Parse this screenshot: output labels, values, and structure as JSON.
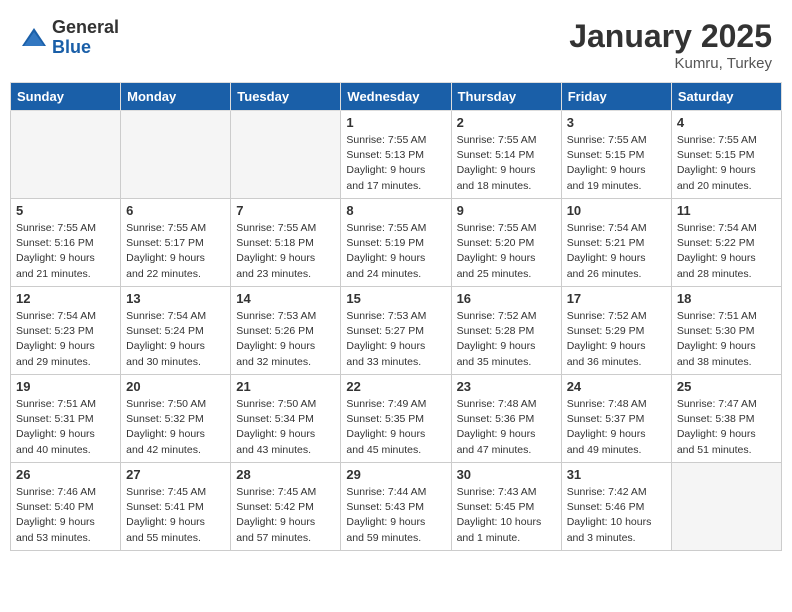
{
  "header": {
    "logo_general": "General",
    "logo_blue": "Blue",
    "title": "January 2025",
    "subtitle": "Kumru, Turkey"
  },
  "days_of_week": [
    "Sunday",
    "Monday",
    "Tuesday",
    "Wednesday",
    "Thursday",
    "Friday",
    "Saturday"
  ],
  "weeks": [
    [
      {
        "day": "",
        "info": ""
      },
      {
        "day": "",
        "info": ""
      },
      {
        "day": "",
        "info": ""
      },
      {
        "day": "1",
        "info": "Sunrise: 7:55 AM\nSunset: 5:13 PM\nDaylight: 9 hours\nand 17 minutes."
      },
      {
        "day": "2",
        "info": "Sunrise: 7:55 AM\nSunset: 5:14 PM\nDaylight: 9 hours\nand 18 minutes."
      },
      {
        "day": "3",
        "info": "Sunrise: 7:55 AM\nSunset: 5:15 PM\nDaylight: 9 hours\nand 19 minutes."
      },
      {
        "day": "4",
        "info": "Sunrise: 7:55 AM\nSunset: 5:15 PM\nDaylight: 9 hours\nand 20 minutes."
      }
    ],
    [
      {
        "day": "5",
        "info": "Sunrise: 7:55 AM\nSunset: 5:16 PM\nDaylight: 9 hours\nand 21 minutes."
      },
      {
        "day": "6",
        "info": "Sunrise: 7:55 AM\nSunset: 5:17 PM\nDaylight: 9 hours\nand 22 minutes."
      },
      {
        "day": "7",
        "info": "Sunrise: 7:55 AM\nSunset: 5:18 PM\nDaylight: 9 hours\nand 23 minutes."
      },
      {
        "day": "8",
        "info": "Sunrise: 7:55 AM\nSunset: 5:19 PM\nDaylight: 9 hours\nand 24 minutes."
      },
      {
        "day": "9",
        "info": "Sunrise: 7:55 AM\nSunset: 5:20 PM\nDaylight: 9 hours\nand 25 minutes."
      },
      {
        "day": "10",
        "info": "Sunrise: 7:54 AM\nSunset: 5:21 PM\nDaylight: 9 hours\nand 26 minutes."
      },
      {
        "day": "11",
        "info": "Sunrise: 7:54 AM\nSunset: 5:22 PM\nDaylight: 9 hours\nand 28 minutes."
      }
    ],
    [
      {
        "day": "12",
        "info": "Sunrise: 7:54 AM\nSunset: 5:23 PM\nDaylight: 9 hours\nand 29 minutes."
      },
      {
        "day": "13",
        "info": "Sunrise: 7:54 AM\nSunset: 5:24 PM\nDaylight: 9 hours\nand 30 minutes."
      },
      {
        "day": "14",
        "info": "Sunrise: 7:53 AM\nSunset: 5:26 PM\nDaylight: 9 hours\nand 32 minutes."
      },
      {
        "day": "15",
        "info": "Sunrise: 7:53 AM\nSunset: 5:27 PM\nDaylight: 9 hours\nand 33 minutes."
      },
      {
        "day": "16",
        "info": "Sunrise: 7:52 AM\nSunset: 5:28 PM\nDaylight: 9 hours\nand 35 minutes."
      },
      {
        "day": "17",
        "info": "Sunrise: 7:52 AM\nSunset: 5:29 PM\nDaylight: 9 hours\nand 36 minutes."
      },
      {
        "day": "18",
        "info": "Sunrise: 7:51 AM\nSunset: 5:30 PM\nDaylight: 9 hours\nand 38 minutes."
      }
    ],
    [
      {
        "day": "19",
        "info": "Sunrise: 7:51 AM\nSunset: 5:31 PM\nDaylight: 9 hours\nand 40 minutes."
      },
      {
        "day": "20",
        "info": "Sunrise: 7:50 AM\nSunset: 5:32 PM\nDaylight: 9 hours\nand 42 minutes."
      },
      {
        "day": "21",
        "info": "Sunrise: 7:50 AM\nSunset: 5:34 PM\nDaylight: 9 hours\nand 43 minutes."
      },
      {
        "day": "22",
        "info": "Sunrise: 7:49 AM\nSunset: 5:35 PM\nDaylight: 9 hours\nand 45 minutes."
      },
      {
        "day": "23",
        "info": "Sunrise: 7:48 AM\nSunset: 5:36 PM\nDaylight: 9 hours\nand 47 minutes."
      },
      {
        "day": "24",
        "info": "Sunrise: 7:48 AM\nSunset: 5:37 PM\nDaylight: 9 hours\nand 49 minutes."
      },
      {
        "day": "25",
        "info": "Sunrise: 7:47 AM\nSunset: 5:38 PM\nDaylight: 9 hours\nand 51 minutes."
      }
    ],
    [
      {
        "day": "26",
        "info": "Sunrise: 7:46 AM\nSunset: 5:40 PM\nDaylight: 9 hours\nand 53 minutes."
      },
      {
        "day": "27",
        "info": "Sunrise: 7:45 AM\nSunset: 5:41 PM\nDaylight: 9 hours\nand 55 minutes."
      },
      {
        "day": "28",
        "info": "Sunrise: 7:45 AM\nSunset: 5:42 PM\nDaylight: 9 hours\nand 57 minutes."
      },
      {
        "day": "29",
        "info": "Sunrise: 7:44 AM\nSunset: 5:43 PM\nDaylight: 9 hours\nand 59 minutes."
      },
      {
        "day": "30",
        "info": "Sunrise: 7:43 AM\nSunset: 5:45 PM\nDaylight: 10 hours\nand 1 minute."
      },
      {
        "day": "31",
        "info": "Sunrise: 7:42 AM\nSunset: 5:46 PM\nDaylight: 10 hours\nand 3 minutes."
      },
      {
        "day": "",
        "info": ""
      }
    ]
  ]
}
